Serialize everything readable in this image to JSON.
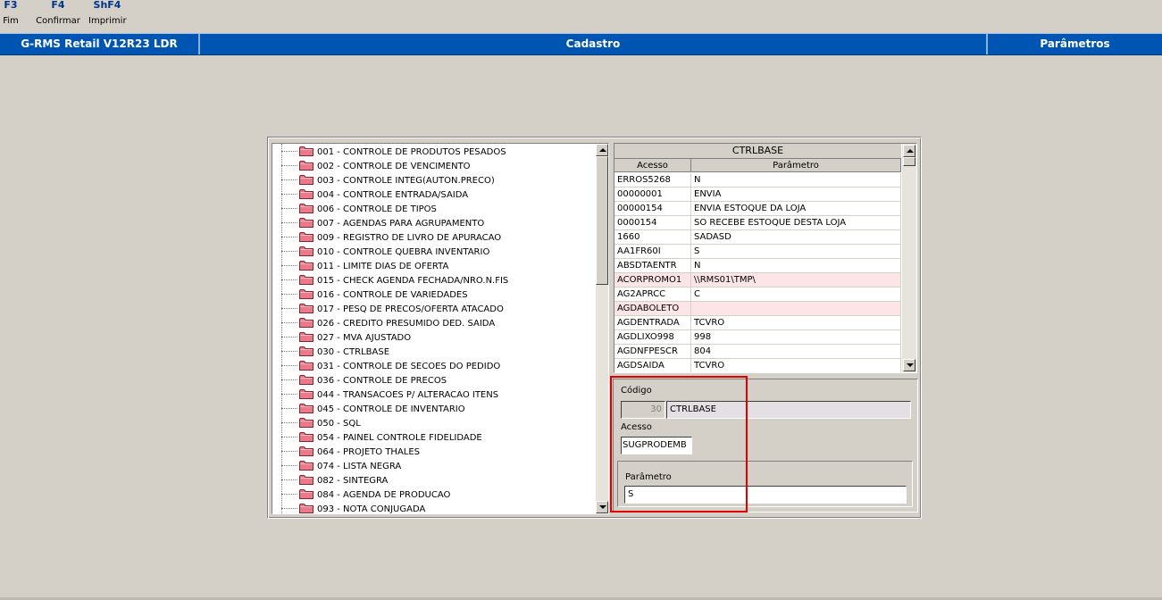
{
  "function_keys": [
    {
      "key": "F3",
      "label": "Fim"
    },
    {
      "key": "F4",
      "label": "Confirmar"
    },
    {
      "key": "ShF4",
      "label": "Imprimir"
    }
  ],
  "titlebar": {
    "app": "G-RMS Retail V12R23 LDR",
    "section": "Cadastro",
    "area": "Parâmetros"
  },
  "tree": {
    "items": [
      "001 - CONTROLE DE PRODUTOS PESADOS",
      "002 - CONTROLE DE VENCIMENTO",
      "003 - CONTROLE INTEG(AUTON.PRECO)",
      "004 - CONTROLE ENTRADA/SAIDA",
      "006 - CONTROLE DE TIPOS",
      "007 - AGENDAS PARA AGRUPAMENTO",
      "009 - REGISTRO DE LIVRO DE APURACAO",
      "010 - CONTROLE QUEBRA INVENTARIO",
      "011 - LIMITE DIAS DE OFERTA",
      "015 - CHECK AGENDA FECHADA/NRO.N.FIS",
      "016 - CONTROLE DE VARIEDADES",
      "017 - PESQ DE PRECOS/OFERTA ATACADO",
      "026 - CREDITO PRESUMIDO DED. SAIDA",
      "027 - MVA AJUSTADO",
      "030 - CTRLBASE",
      "031 - CONTROLE DE SECOES DO PEDIDO",
      "036 - CONTROLE DE PRECOS",
      "044 - TRANSACOES P/ ALTERACAO ITENS",
      "045 - CONTROLE DE INVENTARIO",
      "050 - SQL",
      "054 - PAINEL CONTROLE FIDELIDADE",
      "064 - PROJETO THALES",
      "074 - LISTA NEGRA",
      "082 - SINTEGRA",
      "084 - AGENDA DE PRODUCAO",
      "093 - NOTA CONJUGADA"
    ]
  },
  "grid": {
    "title": "CTRLBASE",
    "col_acesso": "Acesso",
    "col_parametro": "Parâmetro",
    "rows": [
      {
        "acesso": " ERROS5268",
        "parametro": "N",
        "highlight": false
      },
      {
        "acesso": "00000001",
        "parametro": "ENVIA",
        "highlight": false
      },
      {
        "acesso": "00000154",
        "parametro": "ENVIA ESTOQUE DA LOJA",
        "highlight": false
      },
      {
        "acesso": "0000154",
        "parametro": "SO RECEBE ESTOQUE DESTA LOJA",
        "highlight": false
      },
      {
        "acesso": "1660",
        "parametro": "SADASD",
        "highlight": false
      },
      {
        "acesso": "AA1FR60I",
        "parametro": "S",
        "highlight": false
      },
      {
        "acesso": "ABSDTAENTR",
        "parametro": "N",
        "highlight": false
      },
      {
        "acesso": "ACORPROMO1",
        "parametro": "\\\\RMS01\\TMP\\",
        "highlight": true
      },
      {
        "acesso": "AG2APRCC",
        "parametro": "C",
        "highlight": false
      },
      {
        "acesso": "AGDABOLETO",
        "parametro": "",
        "highlight": true
      },
      {
        "acesso": "AGDENTRADA",
        "parametro": "TCVRO",
        "highlight": false
      },
      {
        "acesso": "AGDLIXO998",
        "parametro": "998",
        "highlight": false
      },
      {
        "acesso": "AGDNFPESCR",
        "parametro": "804",
        "highlight": false
      },
      {
        "acesso": "AGDSAIDA",
        "parametro": "TCVRO",
        "highlight": false
      }
    ]
  },
  "detail": {
    "codigo_label": "Código",
    "codigo_value": "30",
    "codigo_desc": "CTRLBASE",
    "acesso_label": "Acesso",
    "acesso_value": "SUGPRODEMB",
    "parametro_label": "Parâmetro",
    "parametro_value": "S"
  },
  "colors": {
    "titlebar": "#0055b3",
    "function_key": "#00348c",
    "highlight_row": "#fde4e6",
    "annotation": "#e00000"
  }
}
